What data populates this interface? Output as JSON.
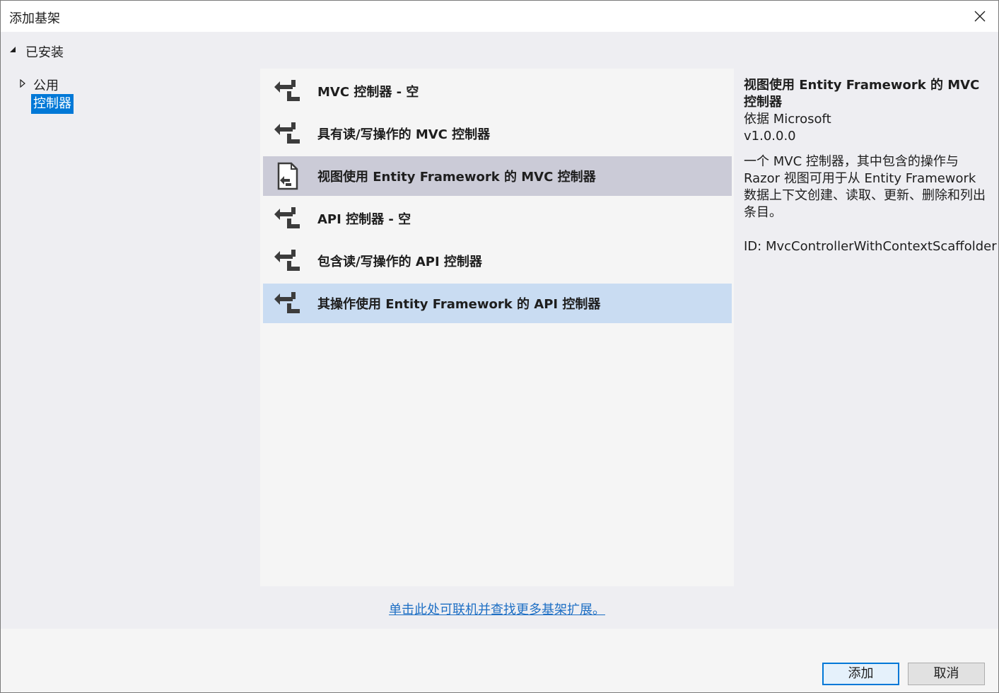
{
  "window": {
    "title": "添加基架"
  },
  "tree": {
    "installed_label": "已安装",
    "items": [
      {
        "label": "公用"
      },
      {
        "label": "控制器"
      }
    ]
  },
  "scaffolds": [
    {
      "name": "MVC 控制器 - 空",
      "icon": "controller-icon"
    },
    {
      "name": "具有读/写操作的 MVC 控制器",
      "icon": "controller-icon"
    },
    {
      "name": "视图使用 Entity Framework 的 MVC 控制器",
      "icon": "view-controller-icon"
    },
    {
      "name": "API 控制器 - 空",
      "icon": "controller-icon"
    },
    {
      "name": "包含读/写操作的 API 控制器",
      "icon": "controller-icon"
    },
    {
      "name": "其操作使用 Entity Framework 的 API 控制器",
      "icon": "controller-icon"
    }
  ],
  "details": {
    "title": "视图使用 Entity Framework 的 MVC 控制器",
    "author": "依据 Microsoft",
    "version": "v1.0.0.0",
    "description": "一个 MVC 控制器，其中包含的操作与 Razor 视图可用于从 Entity Framework 数据上下文创建、读取、更新、删除和列出条目。",
    "id": "ID: MvcControllerWithContextScaffolder"
  },
  "online_link": "单击此处可联机并查找更多基架扩展。",
  "buttons": {
    "add": "添加",
    "cancel": "取消"
  },
  "colors": {
    "tree_selected": "#0078d7",
    "list_selected_inactive": "#cbcbd7",
    "list_hover": "#c9dcf2",
    "link": "#1e6fc4"
  }
}
